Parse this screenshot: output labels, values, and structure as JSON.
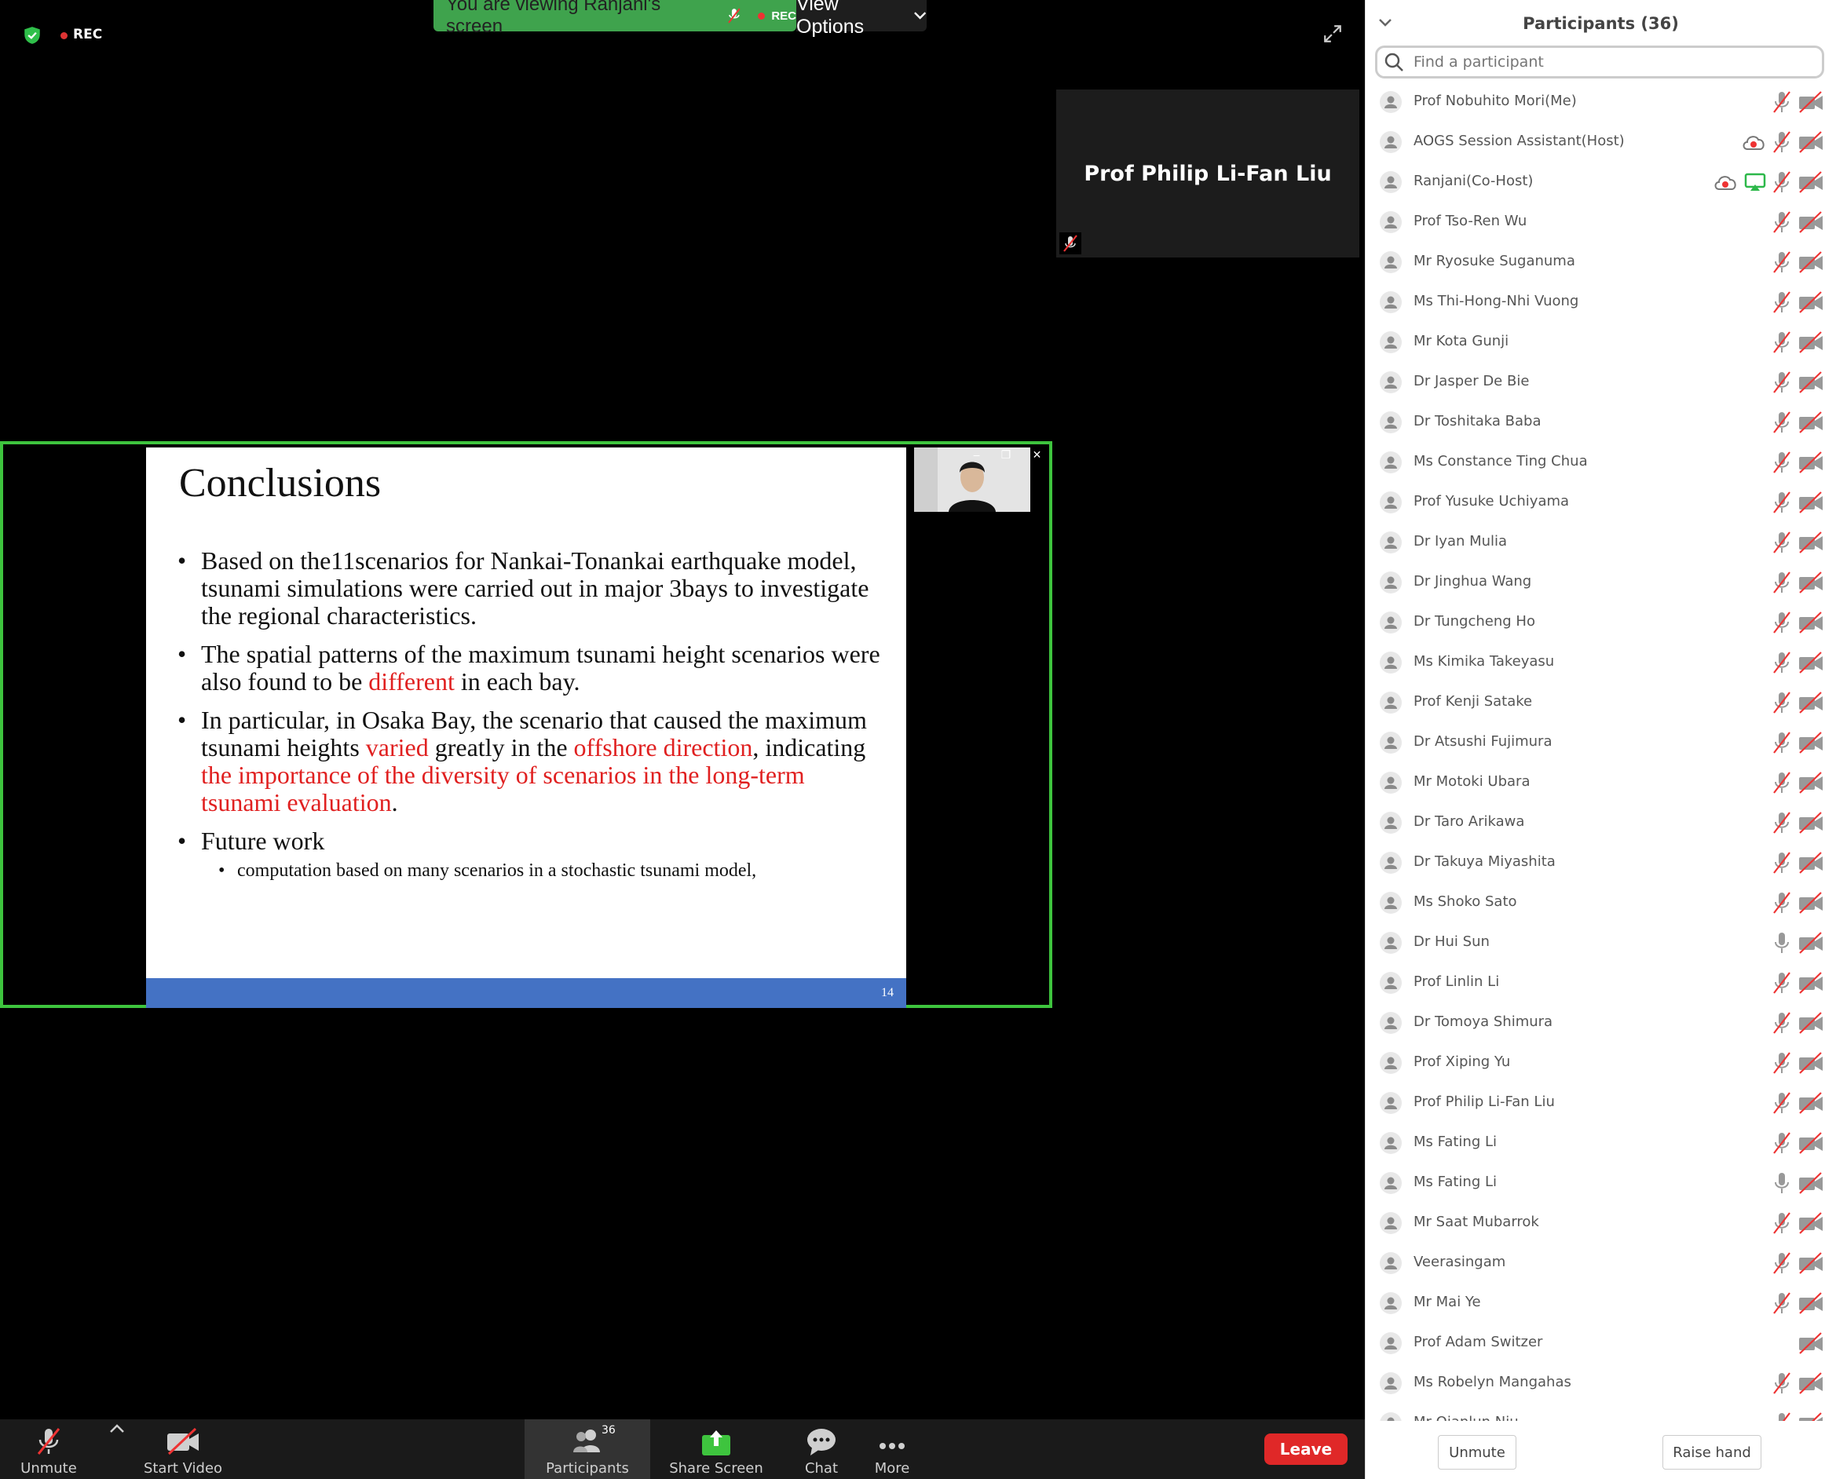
{
  "top": {
    "rec_label": "REC",
    "viewing_text": "You are viewing Ranjani's screen",
    "viewing_rec": "REC",
    "view_options": "View Options"
  },
  "thumbnail": {
    "name": "Prof Philip Li-Fan Liu"
  },
  "slide": {
    "title": "Conclusions",
    "bullet1": "Based on the11scenarios for Nankai-Tonankai earthquake model, tsunami simulations were carried out in major 3bays to investigate the regional characteristics.",
    "bullet2_a": "The spatial patterns of the maximum tsunami height scenarios were also found to be ",
    "bullet2_red": "different",
    "bullet2_b": " in each bay.",
    "bullet3_a": "In particular, in Osaka Bay, the scenario that caused the maximum tsunami heights ",
    "bullet3_red1": "varied",
    "bullet3_b": " greatly in the ",
    "bullet3_red2": "offshore direction",
    "bullet3_c": ", indicating ",
    "bullet3_red3": "the importance of the diversity of scenarios in the long-term tsunami evaluation",
    "bullet3_d": ".",
    "bullet4": "Future work",
    "sub_bullet": "computation based on many scenarios in a stochastic tsunami model,",
    "page_number": "14"
  },
  "toolbar": {
    "unmute": "Unmute",
    "start_video": "Start Video",
    "participants": "Participants",
    "participants_count": "36",
    "share_screen": "Share Screen",
    "chat": "Chat",
    "more": "More",
    "leave": "Leave"
  },
  "panel": {
    "title": "Participants (36)",
    "search_placeholder": "Find a participant",
    "unmute_button": "Unmute",
    "raise_hand_button": "Raise hand",
    "participants": [
      {
        "name": "Prof Nobuhito Mori(Me)",
        "mic": "muted",
        "video": "off"
      },
      {
        "name": "AOGS Session Assistant(Host)",
        "mic": "muted",
        "video": "off",
        "recording": true
      },
      {
        "name": "Ranjani(Co-Host)",
        "mic": "muted",
        "video": "off",
        "recording": true,
        "sharing": true
      },
      {
        "name": "Prof Tso-Ren Wu",
        "mic": "muted",
        "video": "off"
      },
      {
        "name": "Mr Ryosuke Suganuma",
        "mic": "muted",
        "video": "off"
      },
      {
        "name": "Ms Thi-Hong-Nhi Vuong",
        "mic": "muted",
        "video": "off"
      },
      {
        "name": "Mr Kota Gunji",
        "mic": "muted",
        "video": "off"
      },
      {
        "name": "Dr Jasper De Bie",
        "mic": "muted",
        "video": "off"
      },
      {
        "name": "Dr Toshitaka Baba",
        "mic": "muted",
        "video": "off"
      },
      {
        "name": "Ms Constance Ting Chua",
        "mic": "muted",
        "video": "off"
      },
      {
        "name": "Prof Yusuke Uchiyama",
        "mic": "muted",
        "video": "off"
      },
      {
        "name": "Dr Iyan Mulia",
        "mic": "muted",
        "video": "off"
      },
      {
        "name": "Dr Jinghua Wang",
        "mic": "muted",
        "video": "off"
      },
      {
        "name": "Dr Tungcheng Ho",
        "mic": "muted",
        "video": "off"
      },
      {
        "name": "Ms Kimika Takeyasu",
        "mic": "muted",
        "video": "off"
      },
      {
        "name": "Prof Kenji Satake",
        "mic": "muted",
        "video": "off"
      },
      {
        "name": "Dr Atsushi Fujimura",
        "mic": "muted",
        "video": "off"
      },
      {
        "name": "Mr Motoki Ubara",
        "mic": "muted",
        "video": "off"
      },
      {
        "name": "Dr Taro Arikawa",
        "mic": "muted",
        "video": "off"
      },
      {
        "name": "Dr Takuya Miyashita",
        "mic": "muted",
        "video": "off"
      },
      {
        "name": "Ms Shoko Sato",
        "mic": "muted",
        "video": "off"
      },
      {
        "name": "Dr Hui Sun",
        "mic": "on",
        "video": "off"
      },
      {
        "name": "Prof Linlin Li",
        "mic": "muted",
        "video": "off"
      },
      {
        "name": "Dr Tomoya Shimura",
        "mic": "muted",
        "video": "off"
      },
      {
        "name": "Prof Xiping Yu",
        "mic": "muted",
        "video": "off"
      },
      {
        "name": "Prof Philip Li-Fan Liu",
        "mic": "muted",
        "video": "off"
      },
      {
        "name": "Ms Fating Li",
        "mic": "muted",
        "video": "off"
      },
      {
        "name": "Ms Fating Li",
        "mic": "on",
        "video": "off"
      },
      {
        "name": "Mr Saat Mubarrok",
        "mic": "muted",
        "video": "off"
      },
      {
        "name": "Veerasingam",
        "mic": "muted",
        "video": "off"
      },
      {
        "name": "Mr Mai Ye",
        "mic": "muted",
        "video": "off"
      },
      {
        "name": "Prof Adam Switzer",
        "mic": "none",
        "video": "off"
      },
      {
        "name": "Ms Robelyn Mangahas",
        "mic": "muted",
        "video": "off"
      },
      {
        "name": "Mr Qianlun Niu",
        "mic": "muted",
        "video": "off"
      }
    ]
  }
}
